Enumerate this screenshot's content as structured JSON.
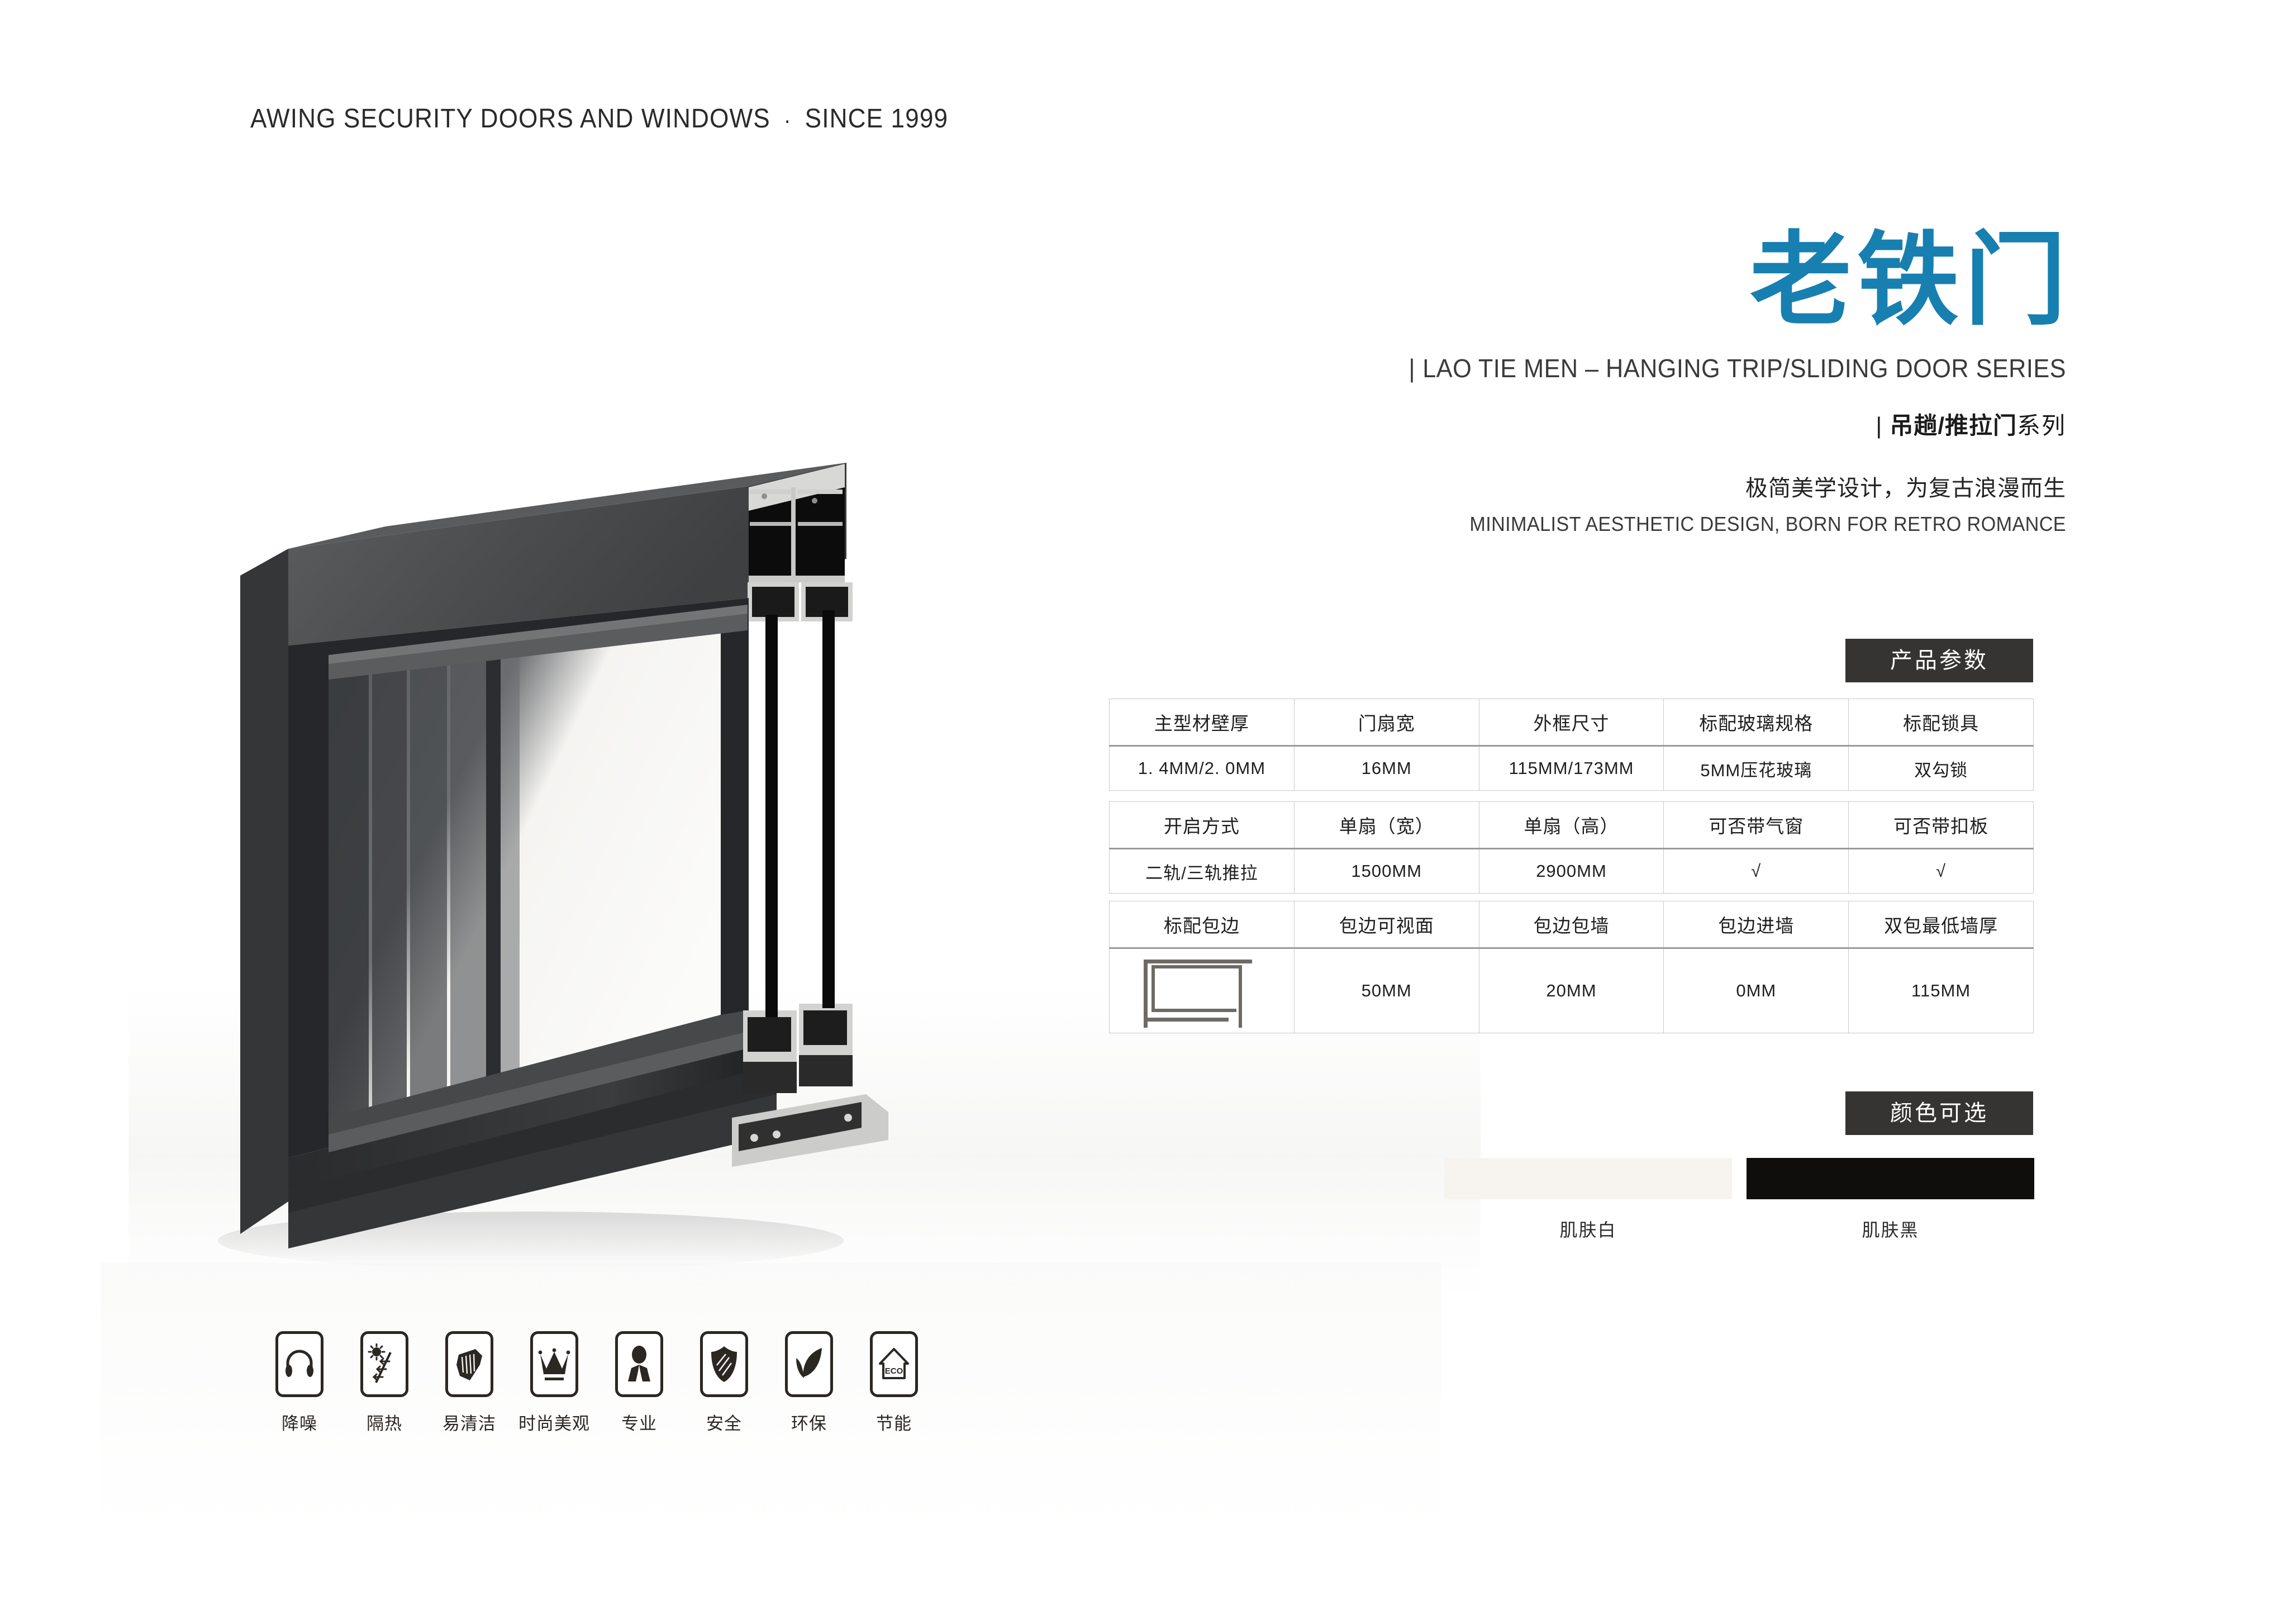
{
  "header": {
    "brand": "AWING SECURITY DOORS AND WINDOWS",
    "separator": "·",
    "since": "SINCE 1999"
  },
  "hero": {
    "title": "老铁门",
    "title_color": "#1780b0",
    "subtitle_en": "LAO TIE MEN – HANGING TRIP/SLIDING DOOR SERIES",
    "series_bold": "吊趟/推拉门",
    "series_light": "系列",
    "tagline_cn": "极简美学设计，为复古浪漫而生",
    "tagline_en": "MINIMALIST AESTHETIC DESIGN, BORN FOR RETRO ROMANCE",
    "bar": "|"
  },
  "badges": {
    "params": "产品参数",
    "colors": "颜色可选",
    "bg": "#363432"
  },
  "tables": [
    {
      "headers": [
        "主型材壁厚",
        "门扇宽",
        "外框尺寸",
        "标配玻璃规格",
        "标配锁具"
      ],
      "values": [
        "1. 4MM/2. 0MM",
        "16MM",
        "115MM/173MM",
        "5MM压花玻璃",
        "双勾锁"
      ]
    },
    {
      "headers": [
        "开启方式",
        "单扇（宽）",
        "单扇（高）",
        "可否带气窗",
        "可否带扣板"
      ],
      "values": [
        "二轨/三轨推拉",
        "1500MM",
        "2900MM",
        "√",
        "√"
      ]
    },
    {
      "headers": [
        "标配包边",
        "包边可视面",
        "包边包墙",
        "包边进墙",
        "双包最低墙厚"
      ],
      "values": [
        "",
        "50MM",
        "20MM",
        "0MM",
        "115MM"
      ],
      "first_cell_icon": "edge-profile-diagram"
    }
  ],
  "colors": [
    {
      "label": "肌肤白",
      "hex": "#f7f4ef"
    },
    {
      "label": "肌肤黑",
      "hex": "#0f0e0c"
    }
  ],
  "features": [
    {
      "label": "降噪",
      "icon": "headphone-icon"
    },
    {
      "label": "隔热",
      "icon": "sun-insulation-icon"
    },
    {
      "label": "易清洁",
      "icon": "wiping-hand-icon"
    },
    {
      "label": "时尚美观",
      "icon": "crown-icon"
    },
    {
      "label": "专业",
      "icon": "person-icon"
    },
    {
      "label": "安全",
      "icon": "shield-icon"
    },
    {
      "label": "环保",
      "icon": "leaves-icon"
    },
    {
      "label": "节能",
      "icon": "eco-house-icon",
      "icon_text": "ECO"
    }
  ],
  "product": {
    "name": "aluminum-sliding-door-frame-render",
    "frame_color": "#3a3a3c",
    "glass_color": "#6e7072"
  }
}
